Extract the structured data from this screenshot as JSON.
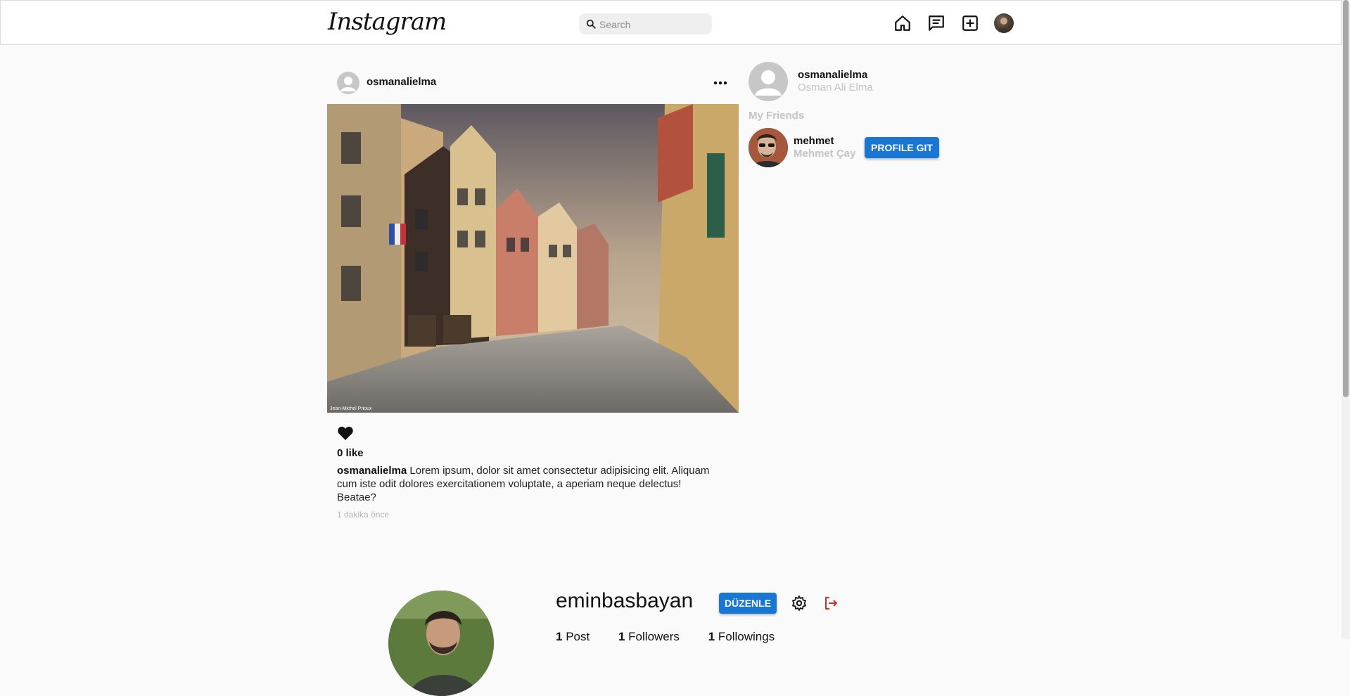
{
  "header": {
    "logo_text": "Instagram",
    "search_placeholder": "Search",
    "icons": [
      "home-icon",
      "messages-icon",
      "add-post-icon",
      "profile-avatar"
    ]
  },
  "post": {
    "username": "osmanalielma",
    "image_credit": "Jean-Michel Prioux",
    "likes_label": "0 like",
    "caption_username": "osmanalielma",
    "caption_text": "Lorem ipsum, dolor sit amet consectetur adipisicing elit. Aliquam cum iste odit dolores exercitationem voluptate, a aperiam neque delectus! Beatae?",
    "timestamp": "1 dakika önce"
  },
  "sidebar": {
    "username": "osmanalielma",
    "fullname": "Osman Ali Elma",
    "friends_title": "My Friends",
    "friends": [
      {
        "username": "mehmet",
        "fullname": "Mehmet Çay",
        "button_label": "PROFILE GIT"
      }
    ]
  },
  "profile": {
    "username": "eminbasbayan",
    "edit_label": "DÜZENLE",
    "stats": [
      {
        "count": "1",
        "label": "Post"
      },
      {
        "count": "1",
        "label": "Followers"
      },
      {
        "count": "1",
        "label": "Followings"
      }
    ]
  },
  "colors": {
    "accent": "#1976d2",
    "logout": "#d32f2f",
    "muted": "#c4c4c4",
    "background": "#fafafa"
  }
}
